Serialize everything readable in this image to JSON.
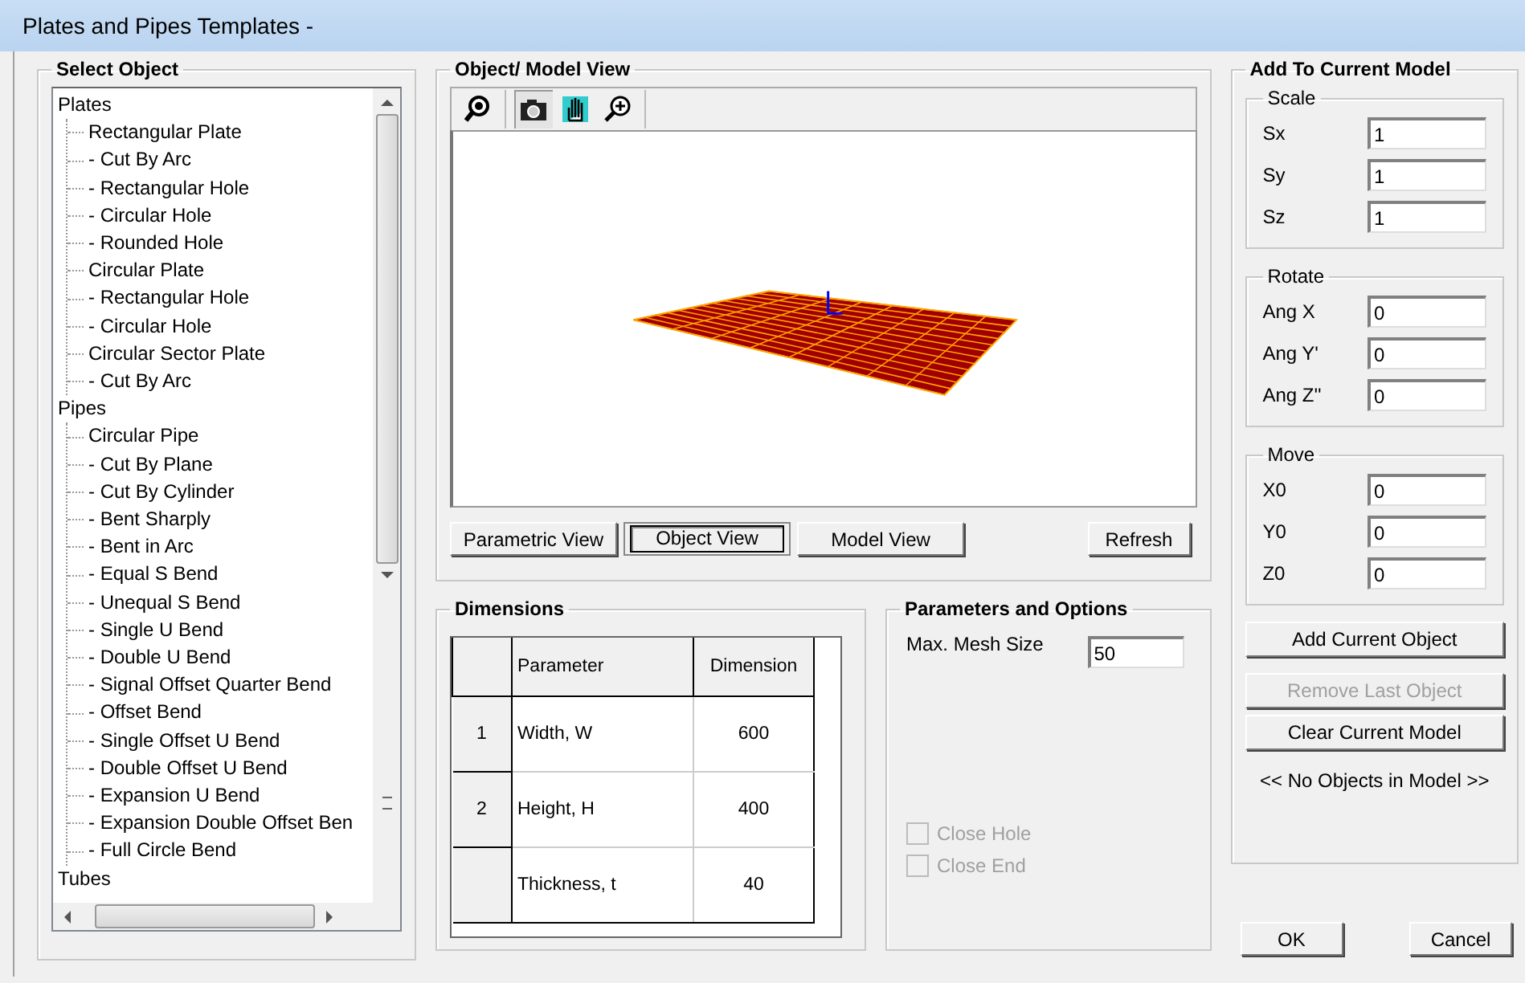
{
  "window": {
    "title": "Plates and Pipes Templates -"
  },
  "select_object": {
    "title": "Select Object",
    "tree": [
      {
        "label": "Plates",
        "children": [
          {
            "label": "Rectangular Plate"
          },
          {
            "label": "- Cut By Arc"
          },
          {
            "label": "- Rectangular Hole"
          },
          {
            "label": "- Circular Hole"
          },
          {
            "label": "- Rounded Hole"
          },
          {
            "label": "Circular Plate"
          },
          {
            "label": "- Rectangular Hole"
          },
          {
            "label": "- Circular Hole"
          },
          {
            "label": "Circular Sector Plate"
          },
          {
            "label": "- Cut By Arc"
          }
        ]
      },
      {
        "label": "Pipes",
        "children": [
          {
            "label": "Circular Pipe"
          },
          {
            "label": "- Cut By Plane"
          },
          {
            "label": "- Cut By Cylinder"
          },
          {
            "label": "- Bent Sharply"
          },
          {
            "label": "- Bent in Arc"
          },
          {
            "label": "- Equal S Bend"
          },
          {
            "label": "- Unequal S Bend"
          },
          {
            "label": "- Single U Bend"
          },
          {
            "label": "- Double U Bend"
          },
          {
            "label": "- Signal Offset Quarter Bend"
          },
          {
            "label": "- Offset Bend"
          },
          {
            "label": "- Single Offset U Bend"
          },
          {
            "label": "- Double Offset U Bend"
          },
          {
            "label": "- Expansion U Bend"
          },
          {
            "label": "- Expansion Double Offset Ben"
          },
          {
            "label": "- Full Circle Bend"
          }
        ]
      },
      {
        "label": "Tubes"
      }
    ]
  },
  "view": {
    "title": "Object/ Model View",
    "toolbar": [
      {
        "kind": "zoom",
        "pressed": false
      },
      {
        "kind": "camera",
        "pressed": true
      },
      {
        "kind": "pan",
        "pressed": false
      },
      {
        "kind": "zoom-in",
        "pressed": false
      }
    ],
    "modes": [
      {
        "label": "Parametric View",
        "selected": false
      },
      {
        "label": "Object View",
        "selected": true
      },
      {
        "label": "Model View",
        "selected": false
      }
    ],
    "refresh": "Refresh"
  },
  "dimensions": {
    "title": "Dimensions",
    "columns": [
      "Parameter",
      "Dimension"
    ],
    "rows": [
      {
        "index": "1",
        "parameter": "Width, W",
        "dimension": "600"
      },
      {
        "index": "2",
        "parameter": "Height, H",
        "dimension": "400"
      },
      {
        "parameter": "Thickness, t",
        "dimension": "40"
      }
    ]
  },
  "parameters": {
    "title": "Parameters and Options",
    "mesh_label": "Max. Mesh Size",
    "mesh_value": "50",
    "options": [
      {
        "label": "Close Hole",
        "checked": false,
        "disabled": true
      },
      {
        "label": "Close End",
        "checked": false,
        "disabled": true
      }
    ]
  },
  "add_to_model": {
    "title": "Add To Current Model",
    "groups": [
      {
        "title": "Scale",
        "fields": [
          {
            "label": "Sx",
            "value": "1"
          },
          {
            "label": "Sy",
            "value": "1"
          },
          {
            "label": "Sz",
            "value": "1"
          }
        ]
      },
      {
        "title": "Rotate",
        "fields": [
          {
            "label": "Ang X",
            "value": "0"
          },
          {
            "label": "Ang Y'",
            "value": "0"
          },
          {
            "label": "Ang Z''",
            "value": "0"
          }
        ]
      },
      {
        "title": "Move",
        "fields": [
          {
            "label": "X0",
            "value": "0"
          },
          {
            "label": "Y0",
            "value": "0"
          },
          {
            "label": "Z0",
            "value": "0"
          }
        ]
      }
    ],
    "buttons": [
      {
        "label": "Add Current Object",
        "disabled": false
      },
      {
        "label": "Remove Last Object",
        "disabled": true
      },
      {
        "label": "Clear Current Model",
        "disabled": false
      }
    ],
    "status": "<< No Objects in Model >>"
  },
  "buttons": [
    "OK",
    "Cancel"
  ]
}
